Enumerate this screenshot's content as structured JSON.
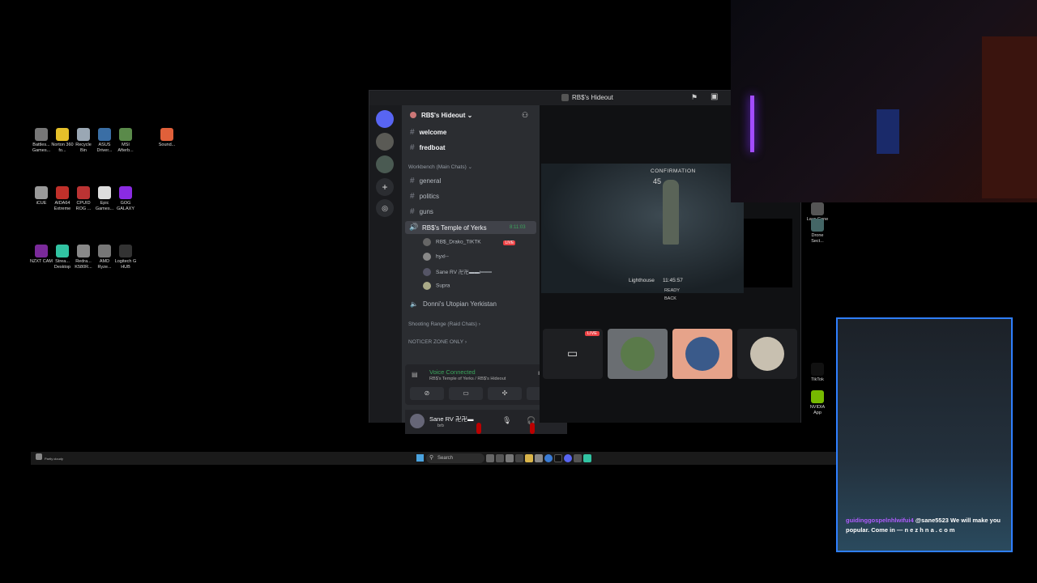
{
  "desktop": {
    "icons_col1": [
      {
        "label": "Battles... Games...",
        "icon": "battlenet-icon",
        "color": "#777"
      },
      {
        "label": "Norton 360 fo...",
        "icon": "norton-icon",
        "color": "#e5c02a"
      },
      {
        "label": "Recycle Bin",
        "icon": "recycle-bin-icon",
        "color": "#9aa7b4"
      },
      {
        "label": "ASUS Driver...",
        "icon": "asus-icon",
        "color": "#3a6ea5"
      },
      {
        "label": "MSI Afterb...",
        "icon": "msi-icon",
        "color": "#5a8a4a"
      },
      {
        "label": "Sound...",
        "icon": "sound-icon",
        "color": "#e0603a"
      }
    ],
    "icons_col2": [
      {
        "label": "iCUE",
        "icon": "icue-icon",
        "color": "#999"
      },
      {
        "label": "AIDA64 Extreme",
        "icon": "aida64-icon",
        "color": "#c0302a"
      },
      {
        "label": "CPUID ROG ...",
        "icon": "cpuid-icon",
        "color": "#b33"
      },
      {
        "label": "Epic Games...",
        "icon": "epic-icon",
        "color": "#ddd"
      },
      {
        "label": "GOG GALAXY",
        "icon": "gog-icon",
        "color": "#8a2be2"
      }
    ],
    "icons_col3": [
      {
        "label": "NZXT CAM",
        "icon": "nzxt-icon",
        "color": "#7a2a9a"
      },
      {
        "label": "Strea... Desktop",
        "icon": "streamlabs-icon",
        "color": "#31c3a2"
      },
      {
        "label": "Redra... K580R...",
        "icon": "redragon-icon",
        "color": "#888"
      },
      {
        "label": "AMD Ryze...",
        "icon": "amd-icon",
        "color": "#777"
      },
      {
        "label": "Logitech G HUB",
        "icon": "ghub-icon",
        "color": "#333"
      }
    ],
    "right_icons": [
      {
        "label": "Lays Gone",
        "icon": "days-gone-icon",
        "color": "#555"
      },
      {
        "label": "Drone Sect...",
        "icon": "drone-icon",
        "color": "#466"
      },
      {
        "label": "TikTok",
        "icon": "tiktok-icon",
        "color": "#111"
      },
      {
        "label": "NVIDIA App",
        "icon": "nvidia-icon",
        "color": "#76b900"
      }
    ]
  },
  "discord": {
    "title": "RB$'s Hideout",
    "server_name": "RB$'s Hideout",
    "text_channels_top": [
      "welcome",
      "fredboat"
    ],
    "category_main": "Workbench (Main Chats)",
    "text_channels": [
      "general",
      "politics",
      "guns"
    ],
    "voice_channel": {
      "name": "RB$'s Temple of Yerks",
      "time": "8:11:03"
    },
    "voice_users": [
      {
        "name": "RB$_Drako_TIKTK",
        "badge": "LIVE"
      },
      {
        "name": "hyxl--"
      },
      {
        "name": "Sane RV 卍卍▬▬ι═══"
      },
      {
        "name": "Supra"
      }
    ],
    "voice_channel_2": "Donni's Utopian Yerkistan",
    "category_raid": "Shooting Range (Raid Chats)",
    "category_noticer": "NOTICER ZONE ONLY",
    "voice_status": {
      "title": "Voice Connected",
      "subtitle": "RB$'s Temple of Yerks / RB$'s Hideout"
    },
    "user": {
      "name": "Sane RV 卍卍▬",
      "status": "brb"
    },
    "stream": {
      "heading": "CONFIRMATION",
      "count": "45",
      "location": "Lighthouse",
      "clock": "11:45:57",
      "ready": "READY",
      "back": "BACK"
    },
    "tiles_live": "LIVE"
  },
  "taskbar": {
    "search": "Search",
    "weather": "Partly cloudy"
  },
  "chat": {
    "username": "guidinggospelnhlwifui4",
    "message": "@sane5523 We will make you popular. Come in — n e z h n a . c o m"
  }
}
